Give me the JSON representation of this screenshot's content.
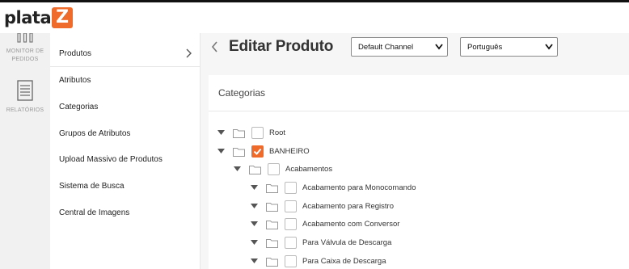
{
  "brand": {
    "logo_prefix": "plata",
    "logo_letter": "Z",
    "accent": "#ef6b2c"
  },
  "rail": {
    "items": [
      {
        "label_line1": "MONITOR DE",
        "label_line2": "PEDIDOS",
        "icon": "bar-chart-icon"
      },
      {
        "label": "RELATÓRIOS",
        "icon": "document-icon"
      }
    ]
  },
  "submenu": {
    "items": [
      {
        "label": "Produtos",
        "active": true
      },
      {
        "label": "Atributos"
      },
      {
        "label": "Categorias"
      },
      {
        "label": "Grupos de Atributos"
      },
      {
        "label": "Upload Massivo de Produtos"
      },
      {
        "label": "Sistema de Busca"
      },
      {
        "label": "Central de Imagens"
      }
    ]
  },
  "main": {
    "title": "Editar Produto",
    "channel_select": "Default Channel",
    "language_select": "Português"
  },
  "categories": {
    "title": "Categorias",
    "tree": [
      {
        "label": "Root",
        "level": 0,
        "checked": false
      },
      {
        "label": "BANHEIRO",
        "level": 0,
        "checked": true
      },
      {
        "label": "Acabamentos",
        "level": 1,
        "checked": false
      },
      {
        "label": "Acabamento para Monocomando",
        "level": 2,
        "checked": false
      },
      {
        "label": "Acabamento para Registro",
        "level": 2,
        "checked": false
      },
      {
        "label": "Acabamento com Conversor",
        "level": 2,
        "checked": false
      },
      {
        "label": "Para Válvula de Descarga",
        "level": 2,
        "checked": false
      },
      {
        "label": "Para Caixa de Descarga",
        "level": 2,
        "checked": false
      }
    ]
  }
}
